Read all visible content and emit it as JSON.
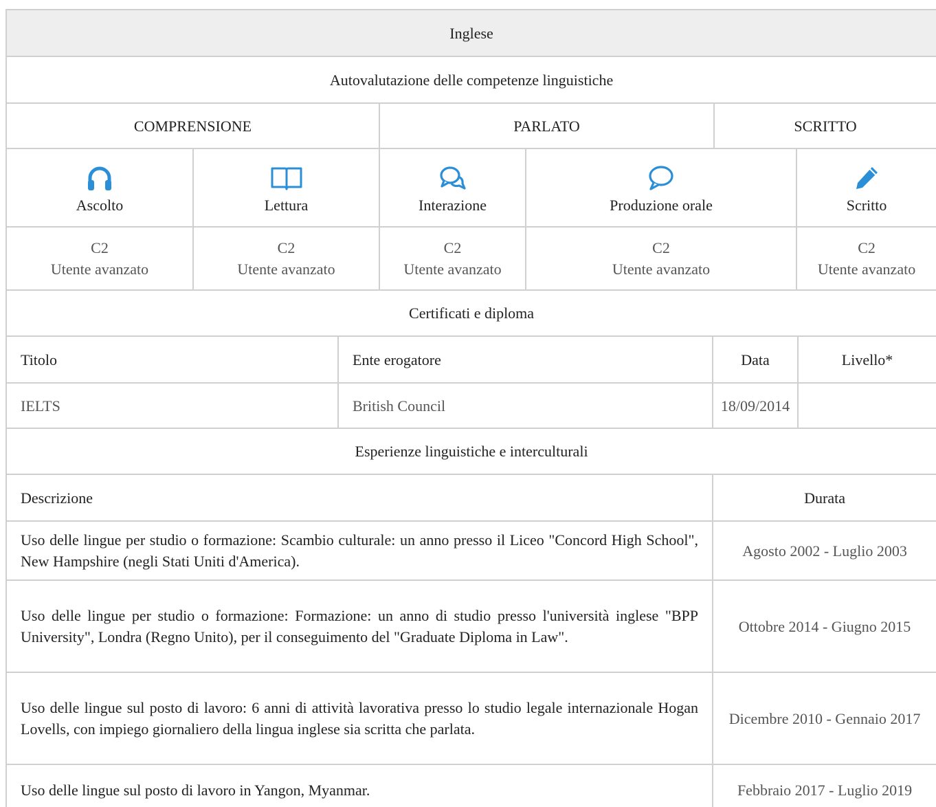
{
  "language": "Inglese",
  "self_assessment_heading": "Autovalutazione delle competenze linguistiche",
  "groups": {
    "comprehension": "COMPRENSIONE",
    "speaking": "PARLATO",
    "writing": "SCRITTO"
  },
  "skills": [
    {
      "label": "Ascolto",
      "icon": "headphones-icon",
      "level": "C2",
      "level_desc": "Utente avanzato"
    },
    {
      "label": "Lettura",
      "icon": "book-icon",
      "level": "C2",
      "level_desc": "Utente avanzato"
    },
    {
      "label": "Interazione",
      "icon": "chat-bubbles-icon",
      "level": "C2",
      "level_desc": "Utente avanzato"
    },
    {
      "label": "Produzione orale",
      "icon": "speech-bubble-icon",
      "level": "C2",
      "level_desc": "Utente avanzato"
    },
    {
      "label": "Scritto",
      "icon": "pencil-icon",
      "level": "C2",
      "level_desc": "Utente avanzato"
    }
  ],
  "certificates": {
    "heading": "Certificati e diploma",
    "columns": {
      "title": "Titolo",
      "issuer": "Ente erogatore",
      "date": "Data",
      "level": "Livello*"
    },
    "rows": [
      {
        "title": "IELTS",
        "issuer": "British Council",
        "date": "18/09/2014",
        "level": ""
      }
    ]
  },
  "experiences": {
    "heading": "Esperienze linguistiche e interculturali",
    "columns": {
      "description": "Descrizione",
      "duration": "Durata"
    },
    "rows": [
      {
        "description": "Uso delle lingue per studio o formazione: Scambio culturale: un anno presso il Liceo \"Concord High School\", New Hampshire (negli Stati Uniti d'America).",
        "duration": "Agosto 2002  - Luglio 2003"
      },
      {
        "description": "Uso delle lingue per studio o formazione: Formazione: un anno di studio presso l'università inglese \"BPP University\", Londra (Regno Unito), per il conseguimento del \"Graduate Diploma in Law\".",
        "duration": "Ottobre 2014 -  Giugno 2015"
      },
      {
        "description": "Uso delle lingue sul posto di lavoro: 6 anni di attività lavorativa presso lo studio legale internazionale Hogan Lovells, con impiego giornaliero della lingua inglese sia scritta che parlata.",
        "duration": "Dicembre 2010 -  Gennaio 2017"
      },
      {
        "description": "Uso delle lingue sul posto di lavoro in Yangon, Myanmar.",
        "duration": "Febbraio 2017 -  Luglio 2019"
      }
    ]
  },
  "colors": {
    "icon_blue": "#2a8fd6",
    "border": "#d0d0d0",
    "header_bg": "#eeeeee"
  }
}
